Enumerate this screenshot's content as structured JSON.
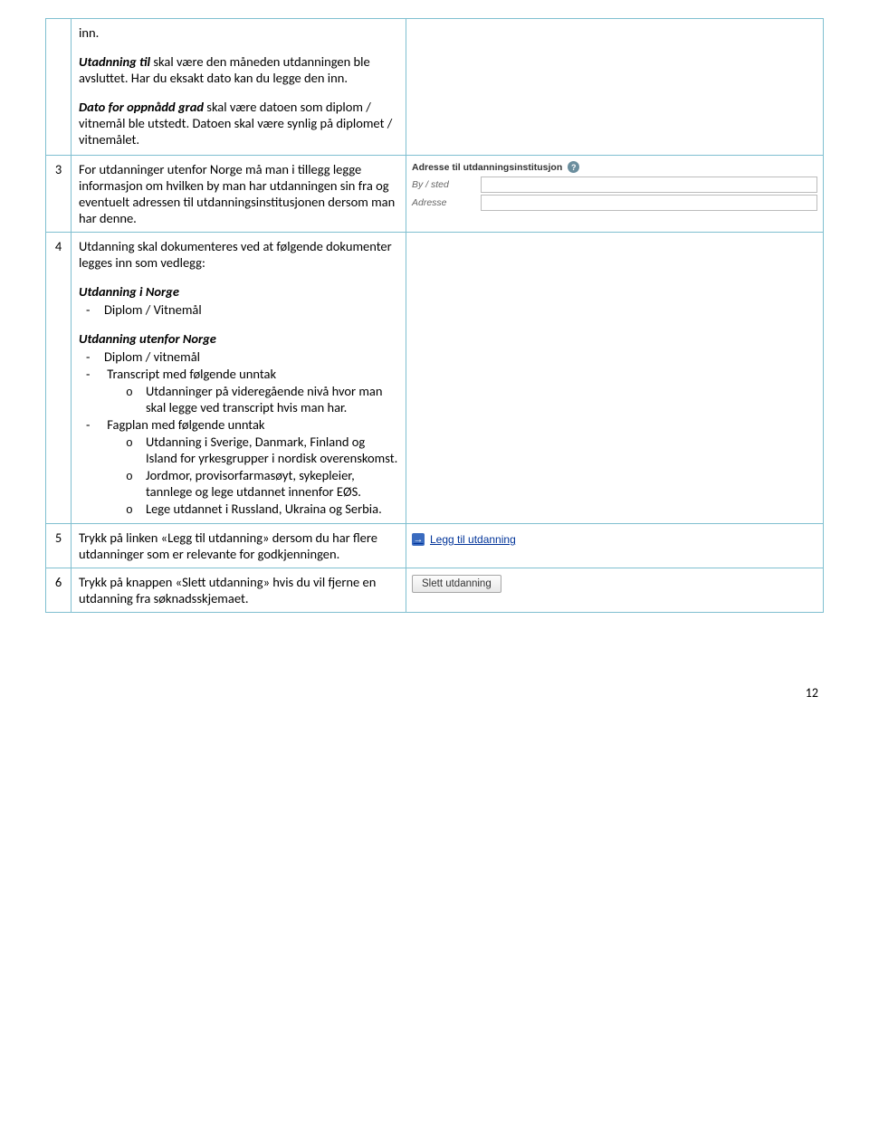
{
  "rows": {
    "r1": {
      "num": "",
      "p_inn": "inn.",
      "p_utadnning_bold": "Utadnning til",
      "p_utadnning_rest": " skal være den måneden utdanningen ble avsluttet. Har du eksakt dato kan du legge den inn.",
      "p_dato_bold": "Dato for oppnådd grad",
      "p_dato_rest": " skal være datoen som diplom / vitnemål ble utstedt. Datoen skal være synlig på diplomet / vitnemålet."
    },
    "r3": {
      "num": "3",
      "text": "For utdanninger utenfor Norge må man i tillegg legge informasjon om hvilken by man har utdanningen sin fra og eventuelt adressen til utdanningsinstitusjonen dersom man har denne.",
      "form": {
        "title": "Adresse til utdanningsinstitusjon",
        "help": "?",
        "label_bysted": "By / sted",
        "label_adresse": "Adresse"
      }
    },
    "r4": {
      "num": "4",
      "intro": "Utdanning skal dokumenteres ved at følgende dokumenter legges inn som vedlegg:",
      "norge_head": "Utdanning i Norge",
      "norge_item": "Diplom / Vitnemål",
      "utenfor_head": "Utdanning utenfor Norge",
      "utenfor_item1": "Diplom / vitnemål",
      "utenfor_item2": "Transcript med følgende unntak",
      "utenfor_item2_sub1": "Utdanninger på videregående nivå hvor man skal legge ved transcript hvis man har.",
      "utenfor_item3": "Fagplan med følgende unntak",
      "utenfor_item3_sub1": "Utdanning i Sverige, Danmark, Finland og Island for yrkesgrupper i nordisk overenskomst.",
      "utenfor_item3_sub2": "Jordmor, provisorfarmasøyt, sykepleier, tannlege og lege utdannet innenfor EØS.",
      "utenfor_item3_sub3": "Lege utdannet i Russland, Ukraina og Serbia."
    },
    "r5": {
      "num": "5",
      "text": "Trykk på linken «Legg til utdanning» dersom du har flere utdanninger som er relevante for godkjenningen.",
      "link": "Legg til utdanning",
      "icon": "→"
    },
    "r6": {
      "num": "6",
      "text": "Trykk på knappen «Slett utdanning» hvis du vil fjerne en utdanning fra søknadsskjemaet.",
      "btn": "Slett utdanning"
    }
  },
  "page_number": "12"
}
